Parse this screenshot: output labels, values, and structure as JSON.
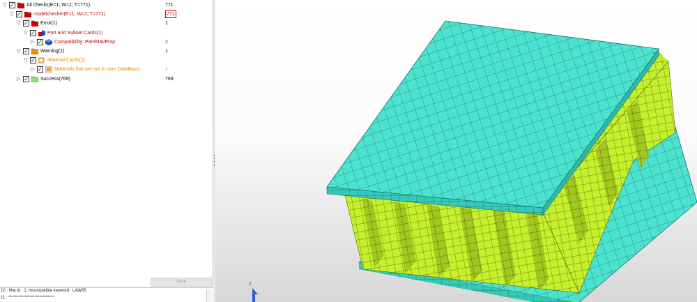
{
  "tree": {
    "rows": [
      {
        "label": "All checks(E=1; W=1; T=771)",
        "count": "771",
        "color": "#000000",
        "toggle": "▽",
        "icon": "red-folder-icon"
      },
      {
        "label": "modelchecker(E=1; W=1; T=771)",
        "count": "771",
        "color": "#c00000",
        "toggle": "▽",
        "icon": "red-folder-icon",
        "boxed": true
      },
      {
        "label": "Error(1)",
        "count": "1",
        "color": "#000000",
        "toggle": "▽",
        "icon": "red-folder-icon"
      },
      {
        "label": "Part and Subset Cards(1)",
        "count": "",
        "color": "#c00000",
        "toggle": "▽",
        "icon": "part-cards-icon"
      },
      {
        "label": "Compatibility: Part/Mat/Prop",
        "count": "2",
        "color": "#c00000",
        "count_color": "#c00000",
        "toggle": "▷",
        "icon": "blue-cube-icon"
      },
      {
        "label": "Warning(1)",
        "count": "1",
        "color": "#000000",
        "toggle": "▽",
        "icon": "orange-folder-icon"
      },
      {
        "label": "Material Cards(1)",
        "count": "",
        "color": "#d88a00",
        "toggle": "▽",
        "icon": "material-cards-icon"
      },
      {
        "label": "Materials that are not in user DataBasis",
        "count": "1",
        "color": "#d88a00",
        "count_color": "#d88a00",
        "toggle": "▷",
        "icon": "material-db-icon"
      },
      {
        "label": "Success(769)",
        "count": "769",
        "color": "#000000",
        "toggle": "▷",
        "icon": "green-folder-icon"
      }
    ]
  },
  "save_label": "Save",
  "console": {
    "lines": [
      "10 : Mat Id : 1, Incompatible keyword : LAW65",
      "11 : ****************************"
    ]
  },
  "viewport": {
    "axis_label": "Z",
    "colors": {
      "plate": "#4be3d0",
      "plate_dark": "#2fb8a8",
      "core": "#c6f02c",
      "core_dark": "#9fc21f",
      "mesh": "#1a6f66"
    }
  },
  "icons": {
    "red-folder-icon": "#d00000",
    "orange-folder-icon": "#f09000",
    "green-folder-icon": "#8be07a",
    "blue-cube-icon": "#1d49c8"
  }
}
